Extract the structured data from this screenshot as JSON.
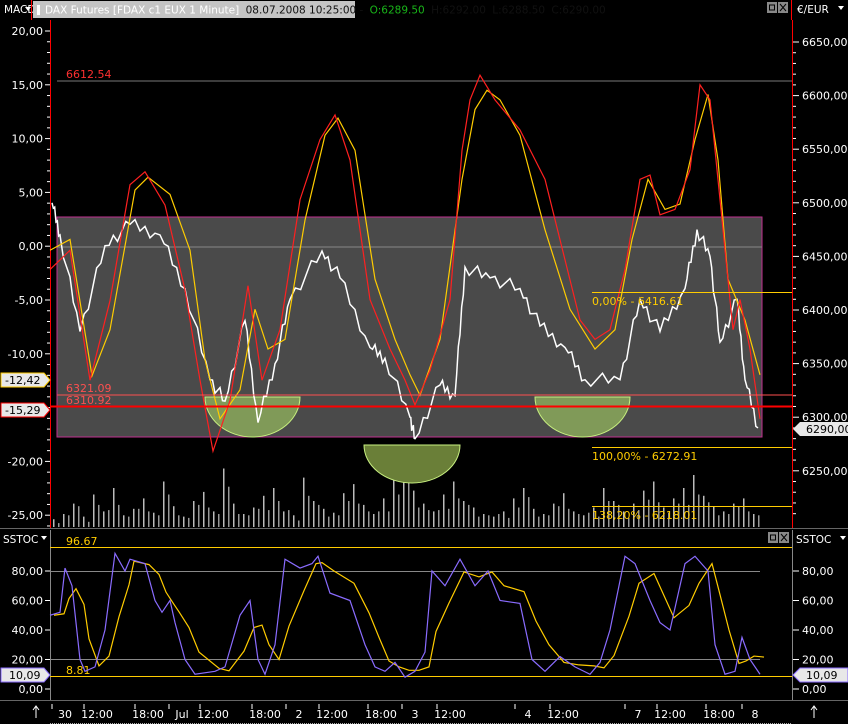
{
  "header": {
    "indicator_dropdown": "MACD",
    "instrument": "DAX Futures [FDAX c1 EUX  1 Minute]",
    "datetime": "08.07.2008 10:25:00 -",
    "open": "O:6289.50",
    "high": "H:6292.00",
    "low": "L:6288.50",
    "close": "C:6290.00",
    "currency_dropdown": "€/EUR"
  },
  "colors": {
    "macd": "#ff2020",
    "signal": "#ffcc00",
    "price": "#ffffff",
    "stoch_k": "#8a6cff",
    "stoch_d": "#ffcc00",
    "fib": "#ffcc00",
    "level_red": "#ff0000",
    "zone": "#8aa85a"
  },
  "left_axis": [
    "20,00",
    "15,00",
    "10,00",
    "5,00",
    "0,00",
    "-5,00",
    "-10,00",
    "-15,00",
    "-20,00",
    "-25,00"
  ],
  "right_axis": [
    "6650,00",
    "6600,00",
    "6550,00",
    "6500,00",
    "6450,00",
    "6400,00",
    "6350,00",
    "6300,00",
    "6250,00"
  ],
  "markers": {
    "macd_value": "-12,42",
    "signal_value": "-15,29",
    "last_price": "6290,00"
  },
  "levels": {
    "high_label": "6612.54",
    "level1": "6321.09",
    "level2": "6310.92"
  },
  "fib": {
    "f0": "0,00% - 6416.61",
    "f100": "100,00% - 6272.91",
    "f138": "138,20% - 6218.01"
  },
  "lower": {
    "dropdown": "SSTOC",
    "right_title": "SSTOC",
    "max_label": "96.67",
    "min_label": "8.81",
    "axis": [
      "80,00",
      "60,00",
      "40,00",
      "20,00",
      "0,00"
    ],
    "value_left": "10,09",
    "value_right": "10,09"
  },
  "time_axis": [
    "30",
    "12:00",
    "18:00",
    "Jul",
    "12:00",
    "18:00",
    "2",
    "12:00",
    "18:00",
    "3",
    "12:00",
    "4",
    "12:00",
    "7",
    "12:00",
    "18:00",
    "8"
  ],
  "chart_data": {
    "type": "line",
    "x_unit": "bar",
    "price": [
      [
        2,
        6500
      ],
      [
        10,
        6470
      ],
      [
        30,
        6380
      ],
      [
        55,
        6460
      ],
      [
        80,
        6480
      ],
      [
        110,
        6470
      ],
      [
        135,
        6420
      ],
      [
        160,
        6335
      ],
      [
        175,
        6315
      ],
      [
        195,
        6390
      ],
      [
        208,
        6295
      ],
      [
        225,
        6350
      ],
      [
        240,
        6410
      ],
      [
        272,
        6455
      ],
      [
        290,
        6430
      ],
      [
        320,
        6365
      ],
      [
        335,
        6355
      ],
      [
        360,
        6300
      ],
      [
        365,
        6280
      ],
      [
        390,
        6330
      ],
      [
        405,
        6320
      ],
      [
        415,
        6440
      ],
      [
        440,
        6430
      ],
      [
        470,
        6420
      ],
      [
        490,
        6385
      ],
      [
        515,
        6365
      ],
      [
        535,
        6335
      ],
      [
        570,
        6335
      ],
      [
        590,
        6410
      ],
      [
        610,
        6380
      ],
      [
        635,
        6420
      ],
      [
        647,
        6475
      ],
      [
        660,
        6450
      ],
      [
        670,
        6370
      ],
      [
        687,
        6410
      ],
      [
        695,
        6335
      ],
      [
        708,
        6290
      ]
    ],
    "macd": [
      [
        0,
        -2.1
      ],
      [
        20,
        -0.3
      ],
      [
        40,
        -12.4
      ],
      [
        60,
        -5
      ],
      [
        80,
        5.8
      ],
      [
        95,
        7
      ],
      [
        115,
        3.9
      ],
      [
        135,
        -4
      ],
      [
        150,
        -12.4
      ],
      [
        163,
        -19
      ],
      [
        180,
        -14.3
      ],
      [
        198,
        -3.6
      ],
      [
        212,
        -12.4
      ],
      [
        230,
        -7.7
      ],
      [
        250,
        4.4
      ],
      [
        270,
        10
      ],
      [
        285,
        12.3
      ],
      [
        300,
        8.1
      ],
      [
        320,
        -4.9
      ],
      [
        340,
        -9.5
      ],
      [
        355,
        -12.4
      ],
      [
        365,
        -14.7
      ],
      [
        380,
        -11.5
      ],
      [
        400,
        -4.9
      ],
      [
        412,
        9
      ],
      [
        420,
        13.7
      ],
      [
        430,
        16
      ],
      [
        445,
        13.7
      ],
      [
        470,
        10.9
      ],
      [
        495,
        6.3
      ],
      [
        515,
        -1.2
      ],
      [
        530,
        -6.8
      ],
      [
        545,
        -8.6
      ],
      [
        560,
        -7.7
      ],
      [
        575,
        -2.1
      ],
      [
        590,
        6.3
      ],
      [
        600,
        6.7
      ],
      [
        610,
        3
      ],
      [
        625,
        3.5
      ],
      [
        640,
        7.2
      ],
      [
        650,
        15.1
      ],
      [
        660,
        13.7
      ],
      [
        670,
        4.4
      ],
      [
        683,
        -7.7
      ],
      [
        690,
        -4.9
      ],
      [
        700,
        -9.5
      ],
      [
        710,
        -16
      ]
    ],
    "signal": [
      [
        0,
        -0.3
      ],
      [
        20,
        0.7
      ],
      [
        42,
        -12
      ],
      [
        60,
        -7.7
      ],
      [
        85,
        5.3
      ],
      [
        98,
        6.5
      ],
      [
        120,
        4.9
      ],
      [
        140,
        -0.3
      ],
      [
        155,
        -10.5
      ],
      [
        170,
        -16
      ],
      [
        190,
        -13.3
      ],
      [
        205,
        -5.8
      ],
      [
        218,
        -9.5
      ],
      [
        235,
        -8.6
      ],
      [
        255,
        2.5
      ],
      [
        275,
        10.4
      ],
      [
        288,
        12
      ],
      [
        305,
        9
      ],
      [
        325,
        -3
      ],
      [
        345,
        -8.6
      ],
      [
        360,
        -11.9
      ],
      [
        370,
        -13.8
      ],
      [
        390,
        -8.6
      ],
      [
        412,
        6.3
      ],
      [
        425,
        12.8
      ],
      [
        437,
        14.6
      ],
      [
        450,
        13.7
      ],
      [
        470,
        10.4
      ],
      [
        495,
        1.6
      ],
      [
        520,
        -5.8
      ],
      [
        545,
        -9.5
      ],
      [
        565,
        -7.7
      ],
      [
        582,
        0.7
      ],
      [
        598,
        6.3
      ],
      [
        615,
        3.5
      ],
      [
        630,
        4
      ],
      [
        645,
        10
      ],
      [
        658,
        14.2
      ],
      [
        668,
        8.1
      ],
      [
        678,
        -3
      ],
      [
        695,
        -6.8
      ],
      [
        710,
        -11.9
      ]
    ],
    "stoch_k": [
      [
        0,
        50
      ],
      [
        10,
        52
      ],
      [
        15,
        82
      ],
      [
        22,
        70
      ],
      [
        30,
        20
      ],
      [
        35,
        12
      ],
      [
        45,
        15
      ],
      [
        55,
        40
      ],
      [
        65,
        92
      ],
      [
        75,
        80
      ],
      [
        80,
        88
      ],
      [
        95,
        85
      ],
      [
        105,
        60
      ],
      [
        112,
        52
      ],
      [
        120,
        60
      ],
      [
        125,
        45
      ],
      [
        135,
        20
      ],
      [
        145,
        10
      ],
      [
        165,
        12
      ],
      [
        175,
        15
      ],
      [
        190,
        50
      ],
      [
        200,
        60
      ],
      [
        208,
        20
      ],
      [
        215,
        10
      ],
      [
        225,
        30
      ],
      [
        235,
        88
      ],
      [
        250,
        82
      ],
      [
        262,
        85
      ],
      [
        268,
        90
      ],
      [
        280,
        65
      ],
      [
        300,
        60
      ],
      [
        315,
        30
      ],
      [
        325,
        15
      ],
      [
        335,
        12
      ],
      [
        345,
        18
      ],
      [
        355,
        8
      ],
      [
        365,
        12
      ],
      [
        375,
        25
      ],
      [
        382,
        80
      ],
      [
        395,
        70
      ],
      [
        410,
        88
      ],
      [
        425,
        70
      ],
      [
        438,
        80
      ],
      [
        450,
        60
      ],
      [
        470,
        58
      ],
      [
        482,
        20
      ],
      [
        495,
        12
      ],
      [
        510,
        22
      ],
      [
        525,
        15
      ],
      [
        540,
        10
      ],
      [
        550,
        18
      ],
      [
        560,
        40
      ],
      [
        575,
        90
      ],
      [
        585,
        85
      ],
      [
        600,
        60
      ],
      [
        610,
        45
      ],
      [
        620,
        40
      ],
      [
        635,
        85
      ],
      [
        645,
        90
      ],
      [
        658,
        80
      ],
      [
        665,
        30
      ],
      [
        675,
        10
      ],
      [
        685,
        12
      ],
      [
        692,
        35
      ],
      [
        700,
        20
      ],
      [
        710,
        10
      ]
    ],
    "volume": [
      6,
      10,
      18,
      8,
      25,
      12,
      30,
      9,
      14,
      22,
      11,
      35,
      16,
      8,
      20,
      27,
      12,
      45,
      18,
      10,
      15,
      24,
      30,
      12,
      9,
      38,
      20,
      14,
      11,
      26,
      33,
      17,
      10,
      22,
      40,
      50,
      28,
      18,
      12,
      25,
      35,
      20,
      15,
      10,
      8,
      12,
      22,
      30,
      14,
      10,
      18,
      26,
      12,
      9,
      15,
      30,
      20,
      12,
      18,
      28,
      35,
      15,
      22,
      30,
      40,
      24,
      16,
      12,
      18,
      22,
      10
    ],
    "macd_ylim": [
      -27,
      22
    ],
    "price_ylim": [
      6225,
      6663
    ],
    "stoch_ylim": [
      -5,
      100
    ]
  }
}
